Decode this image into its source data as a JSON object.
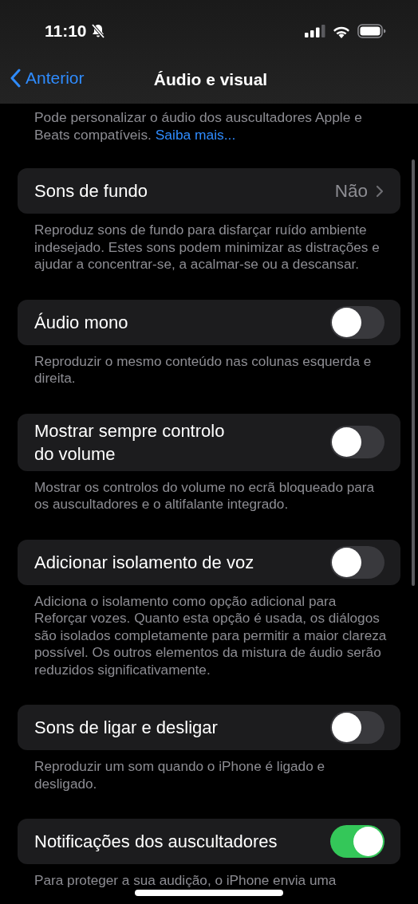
{
  "status_bar": {
    "time": "11:10",
    "silent": true
  },
  "nav": {
    "back": "Anterior",
    "title": "Áudio e visual"
  },
  "intro": {
    "text": "Pode personalizar o áudio dos auscultadores Apple e Beats compatíveis.",
    "link": "Saiba mais..."
  },
  "rows": [
    {
      "kind": "disclosure",
      "label": "Sons de fundo",
      "value": "Não",
      "footer": "Reproduz sons de fundo para disfarçar ruído ambiente indesejado. Estes sons podem minimizar as distrações e ajudar a concentrar-se, a acalmar-se ou a descansar."
    },
    {
      "kind": "toggle",
      "label": "Áudio mono",
      "on": false,
      "footer": "Reproduzir o mesmo conteúdo nas colunas esquerda e direita."
    },
    {
      "kind": "toggle",
      "label": "Mostrar sempre controlo\ndo volume",
      "on": false,
      "footer": "Mostrar os controlos do volume no ecrã bloqueado para os auscultadores e o altifalante integrado."
    },
    {
      "kind": "toggle",
      "label": "Adicionar isolamento de voz",
      "on": false,
      "footer": "Adiciona o isolamento como opção adicional para Reforçar vozes. Quanto esta opção é usada, os diálogos são isolados completamente para permitir a maior clareza possível. Os outros elementos da mistura de áudio serão reduzidos significativamente."
    },
    {
      "kind": "toggle",
      "label": "Sons de ligar e desligar",
      "on": false,
      "footer": "Reproduzir um som quando o iPhone é ligado e desligado."
    },
    {
      "kind": "toggle",
      "label": "Notificações dos auscultadores",
      "on": true,
      "footer": "Para proteger a sua audição, o iPhone envia uma"
    }
  ]
}
